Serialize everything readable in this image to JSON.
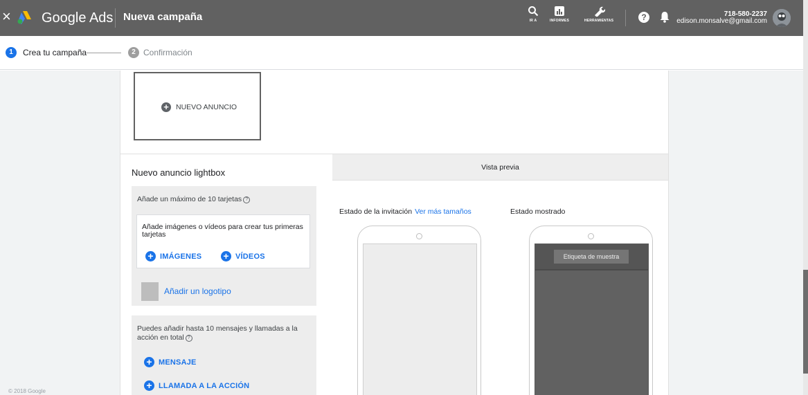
{
  "topbar": {
    "close_icon": "close-icon",
    "logo_icon": "google-ads-logo",
    "brand": "Google Ads",
    "page_title": "Nueva campaña",
    "tools": [
      {
        "icon": "search-icon",
        "label": "IR A"
      },
      {
        "icon": "reports-icon",
        "label": "INFORMES"
      },
      {
        "icon": "wrench-icon",
        "label": "HERRAMIENTAS"
      }
    ],
    "help_icon": "help-icon",
    "bell_icon": "bell-icon",
    "account": {
      "phone": "718-580-2237",
      "email": "edison.monsalve@gmail.com"
    },
    "colors": {
      "bar": "#616161",
      "accent": "#1a73e8"
    }
  },
  "stepper": {
    "steps": [
      {
        "number": "1",
        "label": "Crea tu campaña",
        "state": "active"
      },
      {
        "number": "2",
        "label": "Confirmación",
        "state": "inactive"
      }
    ]
  },
  "card": {
    "new_ad_label": "NUEVO ANUNCIO",
    "section_title": "Nuevo anuncio lightbox",
    "cards_panel": {
      "help_text": "Añade un máximo de 10 tarjetas",
      "prompt": "Añade imágenes o vídeos para crear tus primeras tarjetas",
      "images_button": "IMÁGENES",
      "videos_button": "VÍDEOS",
      "logo_link": "Añadir un logotipo"
    },
    "messages_panel": {
      "help_text": "Puedes añadir hasta 10 mensajes y llamadas a la acción en total",
      "message_button": "MENSAJE",
      "cta_button": "LLAMADA A LA ACCIÓN"
    }
  },
  "preview": {
    "header": "Vista previa",
    "invite_state_label": "Estado de la invitación",
    "more_sizes_link": "Ver más tamaños",
    "shown_state_label": "Estado mostrado",
    "sample_tag": "Etiqueta de muestra"
  },
  "footer": {
    "copyright": "© 2018 Google"
  }
}
